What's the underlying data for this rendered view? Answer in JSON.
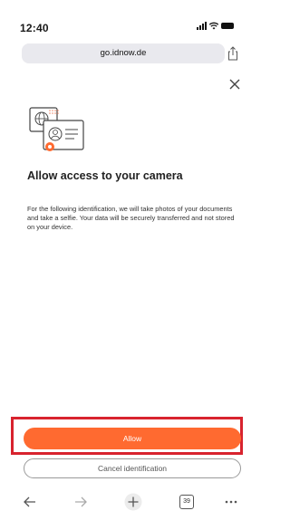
{
  "status_bar": {
    "time": "12:40"
  },
  "browser": {
    "url": "go.idnow.de"
  },
  "content": {
    "title": "Allow access to your camera",
    "body": "For the following identification, we will take photos of your documents and take a selfie. Your data will be securely transferred and not stored on your device."
  },
  "actions": {
    "allow_label": "Allow",
    "cancel_label": "Cancel identification",
    "highlight_color": "#d8232e",
    "accent_color": "#ff6a30"
  },
  "toolbar": {
    "back_icon": "back-arrow-icon",
    "forward_icon": "forward-arrow-icon",
    "new_tab_icon": "plus-icon",
    "tabs_count": "39",
    "more_icon": "more-icon"
  }
}
